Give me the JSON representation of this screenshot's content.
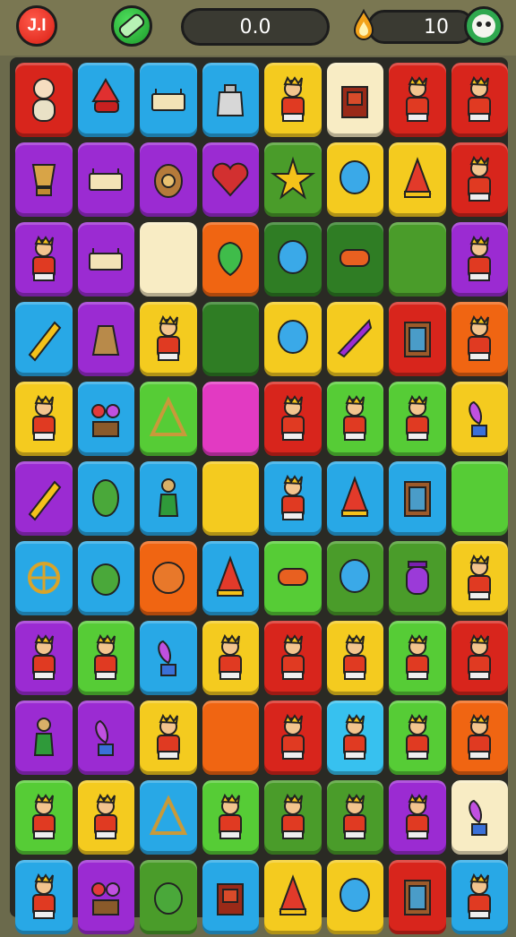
{
  "header": {
    "menu_label": "J.I",
    "score": "0.0",
    "coins": "10",
    "menu_icon": "menu-icon",
    "capsule_icon": "capsule-icon",
    "drop_icon": "flame-drop-icon",
    "mascot_icon": "mascot-avatar-icon"
  },
  "colors": {
    "red": "#d8251c",
    "blue": "#28a8e6",
    "purple": "#9b2bd2",
    "yellow": "#f4cb1f",
    "green": "#4a9c2a",
    "dgreen": "#2f7d24",
    "lime": "#56cc36",
    "orange": "#f06512",
    "cream": "#f8ecc4",
    "magenta": "#e23ac2",
    "cyan": "#37c1ef"
  },
  "board": {
    "rows": [
      [
        [
          "red",
          "baby"
        ],
        [
          "blue",
          "cone-lamp"
        ],
        [
          "blue",
          "sign"
        ],
        [
          "blue",
          "teapot"
        ],
        [
          "yellow",
          "person"
        ],
        [
          "cream",
          "shrine"
        ],
        [
          "red",
          "person"
        ],
        [
          "red",
          "person"
        ]
      ],
      [
        [
          "purple",
          "trophy"
        ],
        [
          "purple",
          "sign"
        ],
        [
          "purple",
          "vase"
        ],
        [
          "purple",
          "heart"
        ],
        [
          "green",
          "star"
        ],
        [
          "yellow",
          "balloon"
        ],
        [
          "yellow",
          "cone"
        ],
        [
          "red",
          "person"
        ]
      ],
      [
        [
          "purple",
          "person"
        ],
        [
          "purple",
          "sign"
        ],
        [
          "cream",
          "empty"
        ],
        [
          "orange",
          "leaf"
        ],
        [
          "dgreen",
          "balloon"
        ],
        [
          "dgreen",
          "roll"
        ],
        [
          "green",
          "empty"
        ],
        [
          "purple",
          "person"
        ]
      ],
      [
        [
          "blue",
          "pencil"
        ],
        [
          "purple",
          "bag"
        ],
        [
          "yellow",
          "person"
        ],
        [
          "dgreen",
          "empty"
        ],
        [
          "yellow",
          "balloon"
        ],
        [
          "yellow",
          "horn"
        ],
        [
          "red",
          "cabinet"
        ],
        [
          "orange",
          "person"
        ]
      ],
      [
        [
          "yellow",
          "person"
        ],
        [
          "blue",
          "flowers"
        ],
        [
          "lime",
          "triangle"
        ],
        [
          "magenta",
          "empty"
        ],
        [
          "red",
          "person"
        ],
        [
          "lime",
          "person"
        ],
        [
          "lime",
          "person"
        ],
        [
          "yellow",
          "plant"
        ]
      ],
      [
        [
          "purple",
          "pencil"
        ],
        [
          "blue",
          "corn"
        ],
        [
          "blue",
          "bird"
        ],
        [
          "yellow",
          "empty"
        ],
        [
          "blue",
          "person"
        ],
        [
          "blue",
          "cone"
        ],
        [
          "blue",
          "cabinet"
        ],
        [
          "lime",
          "empty"
        ]
      ],
      [
        [
          "blue",
          "wheel"
        ],
        [
          "blue",
          "fruit"
        ],
        [
          "orange",
          "ball"
        ],
        [
          "blue",
          "cone"
        ],
        [
          "lime",
          "roll"
        ],
        [
          "green",
          "balloon"
        ],
        [
          "green",
          "jar"
        ],
        [
          "yellow",
          "person"
        ]
      ],
      [
        [
          "purple",
          "person"
        ],
        [
          "lime",
          "person"
        ],
        [
          "blue",
          "plant"
        ],
        [
          "yellow",
          "person"
        ],
        [
          "red",
          "person"
        ],
        [
          "yellow",
          "person"
        ],
        [
          "lime",
          "person"
        ],
        [
          "red",
          "person"
        ]
      ],
      [
        [
          "purple",
          "bird"
        ],
        [
          "purple",
          "plant"
        ],
        [
          "yellow",
          "person"
        ],
        [
          "orange",
          "empty"
        ],
        [
          "red",
          "person"
        ],
        [
          "cyan",
          "person"
        ],
        [
          "lime",
          "person"
        ],
        [
          "orange",
          "person"
        ]
      ],
      [
        [
          "lime",
          "person"
        ],
        [
          "yellow",
          "person"
        ],
        [
          "blue",
          "triangle"
        ],
        [
          "lime",
          "person"
        ],
        [
          "green",
          "person"
        ],
        [
          "green",
          "person"
        ],
        [
          "purple",
          "person"
        ],
        [
          "cream",
          "plant"
        ]
      ],
      [
        [
          "blue",
          "person"
        ],
        [
          "purple",
          "flowers"
        ],
        [
          "green",
          "fruit"
        ],
        [
          "blue",
          "shrine"
        ],
        [
          "yellow",
          "cone"
        ],
        [
          "yellow",
          "balloon"
        ],
        [
          "red",
          "cabinet"
        ],
        [
          "blue",
          "person"
        ]
      ]
    ]
  }
}
